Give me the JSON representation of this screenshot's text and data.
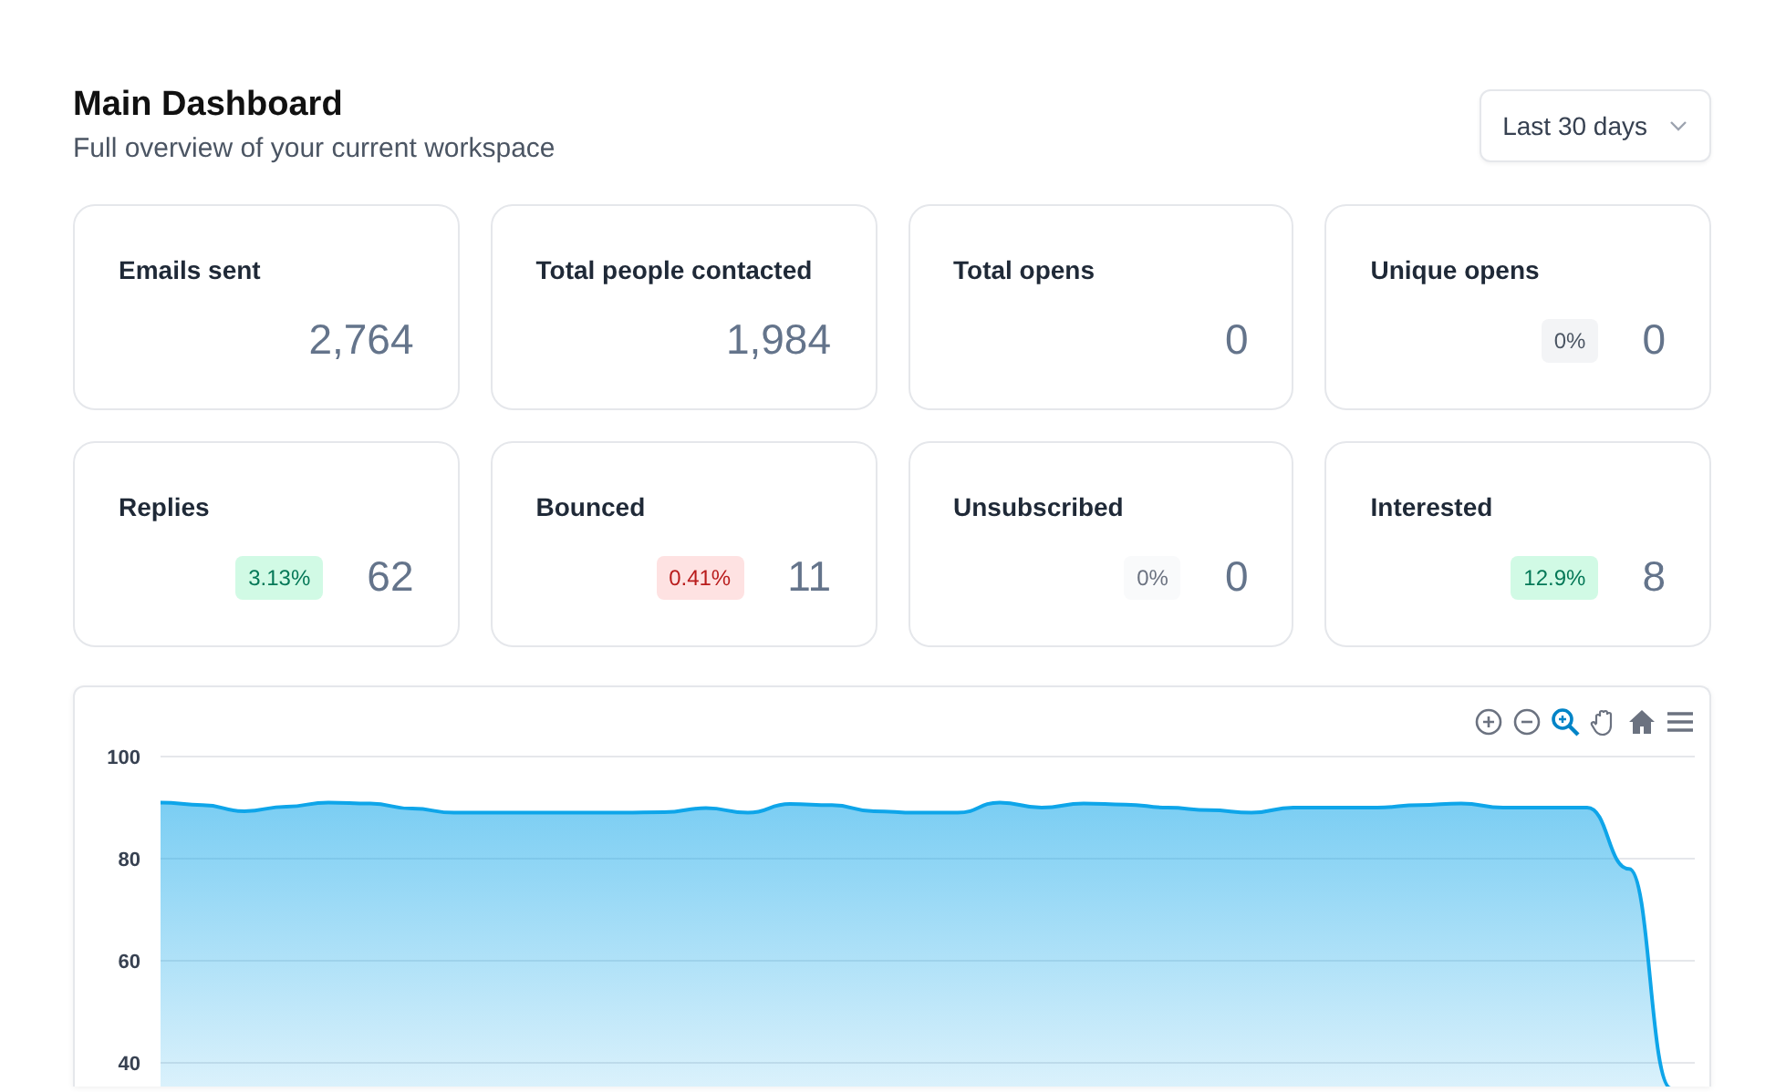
{
  "header": {
    "title": "Main Dashboard",
    "subtitle": "Full overview of your current workspace",
    "range": "Last 30 days"
  },
  "stats": [
    {
      "label": "Emails sent",
      "value": "2,764"
    },
    {
      "label": "Total people contacted",
      "value": "1,984"
    },
    {
      "label": "Total opens",
      "value": "0"
    },
    {
      "label": "Unique opens",
      "value": "0",
      "badge": {
        "text": "0%",
        "kind": "neutral"
      }
    },
    {
      "label": "Replies",
      "value": "62",
      "badge": {
        "text": "3.13%",
        "kind": "success"
      }
    },
    {
      "label": "Bounced",
      "value": "11",
      "badge": {
        "text": "0.41%",
        "kind": "danger"
      }
    },
    {
      "label": "Unsubscribed",
      "value": "0",
      "badge": {
        "text": "0%",
        "kind": "muted"
      }
    },
    {
      "label": "Interested",
      "value": "8",
      "badge": {
        "text": "12.9%",
        "kind": "success"
      }
    }
  ],
  "chart": {
    "toolbar": [
      {
        "kind": "zoom-in",
        "selected": false
      },
      {
        "kind": "zoom-out",
        "selected": false
      },
      {
        "kind": "zoom",
        "selected": true
      },
      {
        "kind": "pan",
        "selected": false
      },
      {
        "kind": "home",
        "selected": false
      },
      {
        "kind": "menu",
        "selected": false
      }
    ],
    "chart_data": {
      "type": "area",
      "yticks": [
        40,
        60,
        80,
        100
      ],
      "ylim": [
        35,
        100
      ],
      "grid": true,
      "series": [
        {
          "color": "#0ea5e9",
          "values": [
            91,
            90.5,
            89.3,
            90.2,
            91,
            90.8,
            89.8,
            89,
            89,
            89,
            89,
            89,
            89.1,
            89.9,
            89,
            90.7,
            90.5,
            89.3,
            89,
            89,
            91,
            90,
            90.8,
            90.6,
            90,
            89.5,
            89,
            90,
            90,
            90,
            90.5,
            90.8,
            90,
            90,
            90,
            78,
            35
          ]
        }
      ]
    }
  }
}
